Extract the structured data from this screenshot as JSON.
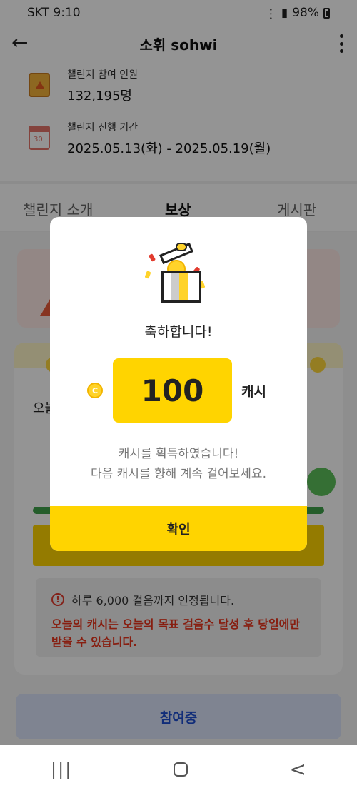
{
  "status_bar": {
    "carrier_time": "SKT 9:10",
    "battery": "98%"
  },
  "header": {
    "title": "소휘 sohwi"
  },
  "info": {
    "participants_label": "챌린지 참여 인원",
    "participants_value": "132,195명",
    "period_label": "챌린지 진행 기간",
    "period_value": "2025.05.13(화) - 2025.05.19(월)"
  },
  "tabs": [
    {
      "label": "챌린지 소개"
    },
    {
      "label": "보상"
    },
    {
      "label": "게시판"
    }
  ],
  "content": {
    "today_label": "오늘",
    "rule_text": "하루 6,000 걸음까지 인정됩니다.",
    "rule_red": "오늘의 캐시는 오늘의 목표 걸음수 달성 후 당일에만 받을 수 있습니다.",
    "join_button": "참여중"
  },
  "dialog": {
    "title": "축하합니다!",
    "amount": "100",
    "unit": "캐시",
    "coin_symbol": "C",
    "message_line1": "캐시를 획득하였습니다!",
    "message_line2": "다음 캐시를 향해 계속 걸어보세요.",
    "confirm_label": "확인"
  },
  "colors": {
    "accent_yellow": "#ffd400",
    "warning_red": "#e8341c",
    "join_blue": "#1e4fd1"
  }
}
